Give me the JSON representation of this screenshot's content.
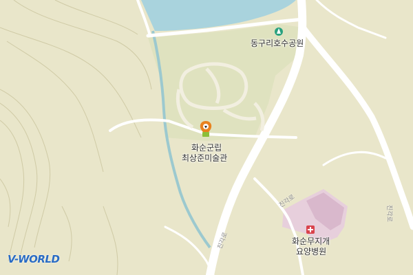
{
  "map": {
    "provider_logo": "V-WORLD",
    "poi_labels": {
      "park": "동구리호수공원",
      "museum_line1": "화순군립",
      "museum_line2": "최상준미술관",
      "hospital_line1": "화순무지개",
      "hospital_line2": "요양병원"
    },
    "road_labels": {
      "road_a": "진각로",
      "road_b": "진각로",
      "road_c": "진각로"
    },
    "icons": {
      "park": "park-icon",
      "museum": "museum-marker-icon",
      "hospital": "hospital-cross-icon"
    },
    "colors": {
      "land": "#e9e6ca",
      "park_area": "#dfe2bf",
      "water": "#a9d3dd",
      "river": "#9cc9cf",
      "road": "#ffffff",
      "hospital_area": "#e7cfdc",
      "museum_marker": "#e8821e",
      "hospital_icon": "#d9434c",
      "park_icon": "#2aa27f",
      "logo": "#2a6cc4"
    }
  }
}
